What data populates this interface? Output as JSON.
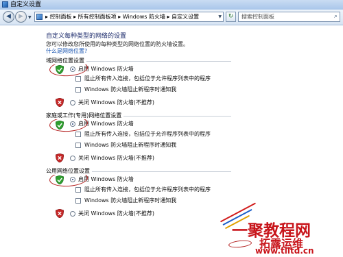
{
  "window": {
    "title": "自定义设置"
  },
  "nav": {
    "back_icon": "back-arrow-icon",
    "forward_icon": "forward-arrow-icon",
    "breadcrumb": "▸ 控制面板 ▸ 所有控制面板项 ▸ Windows 防火墙 ▸ 自定义设置",
    "search_placeholder": "搜索控制面板"
  },
  "content": {
    "heading": "自定义每种类型的网络的设置",
    "description": "您可以修改您所使用的每种类型的网络位置的防火墙设置。",
    "help_link": "什么是网络位置?"
  },
  "sections": [
    {
      "title": "域网络位置设置",
      "enable_label": "启用 Windows 防火墙",
      "enable_selected": true,
      "block_all_label": "阻止所有传入连接，包括位于允许程序列表中的程序",
      "notify_label": "Windows 防火墙阻止新程序时通知我",
      "disable_label": "关闭 Windows 防火墙(不推荐)"
    },
    {
      "title": "家庭或工作(专用)网络位置设置",
      "enable_label": "启用 Windows 防火墙",
      "enable_selected": true,
      "block_all_label": "阻止所有传入连接，包括位于允许程序列表中的程序",
      "notify_label": "Windows 防火墙阻止新程序时通知我",
      "disable_label": "关闭 Windows 防火墙(不推荐)"
    },
    {
      "title": "公用网络位置设置",
      "enable_label": "启用 Windows 防火墙",
      "enable_selected": true,
      "block_all_label": "阻止所有传入连接，包括位于允许程序列表中的程序",
      "notify_label": "Windows 防火墙阻止新程序时通知我",
      "disable_label": "关闭 Windows 防火墙(不推荐)"
    }
  ],
  "watermark": {
    "main": "一聚教程网",
    "sub": "拓露运维",
    "url": "www.tlltd.cn",
    "color": "#c8151b"
  }
}
